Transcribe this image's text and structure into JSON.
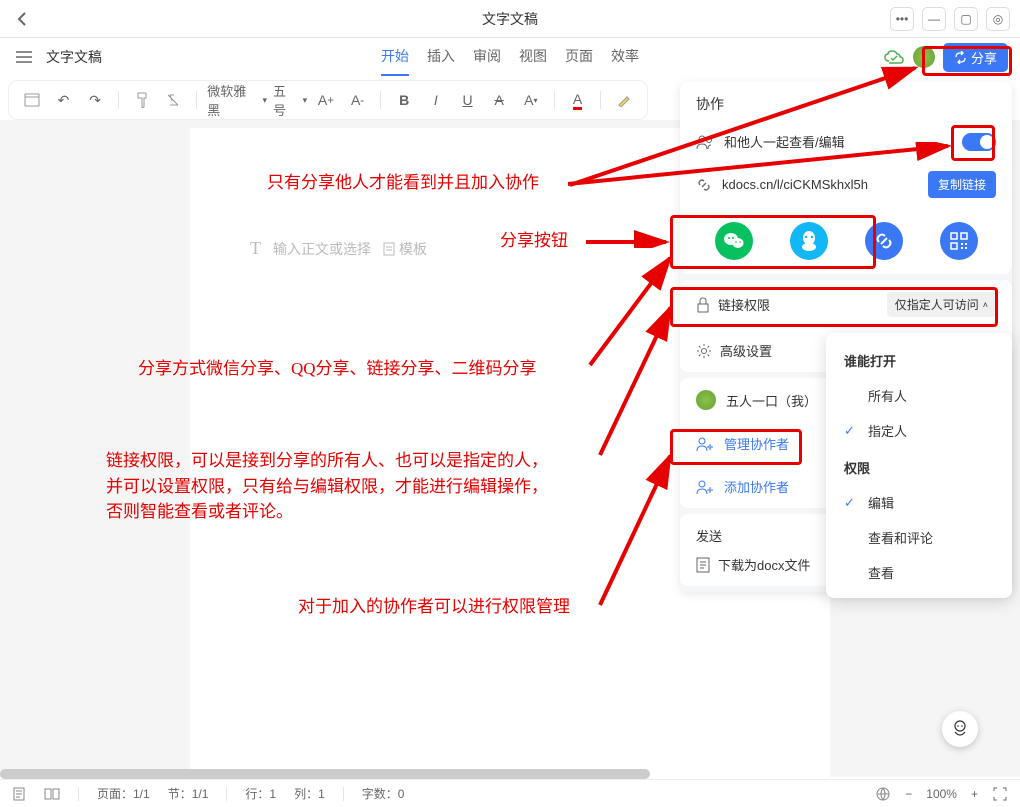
{
  "title": "文字文稿",
  "doc_name": "文字文稿",
  "tabs": [
    "开始",
    "插入",
    "审阅",
    "视图",
    "页面",
    "效率"
  ],
  "active_tab": 0,
  "share_button": "分享",
  "font_name": "微软雅黑",
  "font_size": "五号",
  "placeholder": "输入正文或选择",
  "placeholder_template": "模板",
  "panel": {
    "collab_title": "协作",
    "row_view_edit": "和他人一起查看/编辑",
    "link_url": "kdocs.cn/l/ciCKMSkhxl5h",
    "copy_link": "复制链接",
    "link_perm_label": "链接权限",
    "link_perm_value": "仅指定人可访问",
    "advanced": "高级设置",
    "owner": "五人一口（我）",
    "manage_collab": "管理协作者",
    "add_collab": "添加协作者",
    "send_title": "发送",
    "download_docx": "下载为docx文件"
  },
  "popup": {
    "who": "谁能打开",
    "everyone": "所有人",
    "specified": "指定人",
    "perm": "权限",
    "edit": "编辑",
    "view_comment": "查看和评论",
    "view": "查看"
  },
  "statusbar": {
    "page": "页面：1/1",
    "section": "节：1/1",
    "line": "行：1",
    "col": "列：1",
    "words": "字数：0",
    "zoom": "100%"
  },
  "annotations": {
    "a1": "只有分享他人才能看到并且加入协作",
    "a2": "分享按钮",
    "a3": "分享方式微信分享、QQ分享、链接分享、二维码分享",
    "a4_l1": "链接权限，可以是接到分享的所有人、也可以是指定的人，",
    "a4_l2": "并可以设置权限，只有给与编辑权限，才能进行编辑操作，",
    "a4_l3": "否则智能查看或者评论。",
    "a5": "对于加入的协作者可以进行权限管理"
  }
}
